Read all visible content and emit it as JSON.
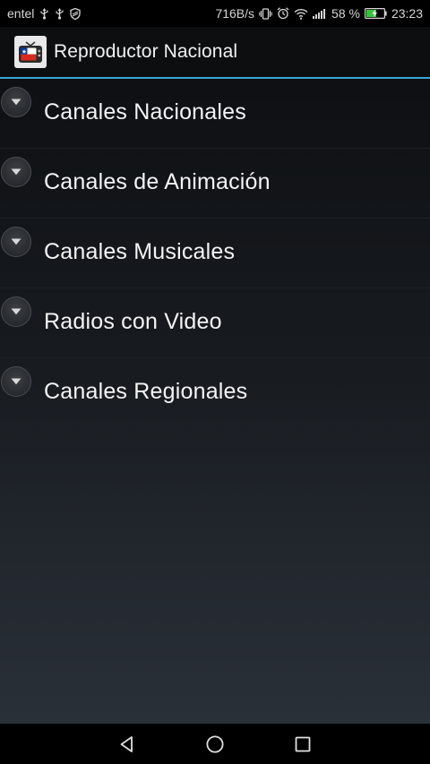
{
  "status_bar": {
    "carrier": "entel",
    "network_speed": "716B/s",
    "battery_percent": "58 %",
    "time": "23:23",
    "left_icons": [
      "usb-icon",
      "usb-icon",
      "shield-icon"
    ],
    "right_icons": [
      "vibrate-icon",
      "alarm-icon",
      "wifi-icon",
      "signal-icon",
      "battery-charging-icon"
    ],
    "battery_level": 0.58
  },
  "action_bar": {
    "title": "Reproductor Nacional",
    "icon": "tv-flag-app-icon",
    "accent_color": "#3aa6d8"
  },
  "categories": [
    {
      "label": "Canales Nacionales"
    },
    {
      "label": "Canales de Animación"
    },
    {
      "label": "Canales Musicales"
    },
    {
      "label": "Radios con Video"
    },
    {
      "label": "Canales Regionales"
    }
  ],
  "nav_bar": {
    "buttons": [
      "back-icon",
      "home-icon",
      "recents-icon"
    ]
  }
}
